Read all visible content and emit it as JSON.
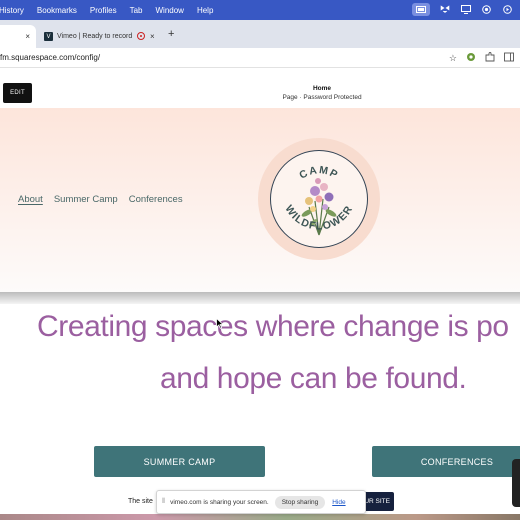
{
  "menubar": {
    "items": [
      "History",
      "Bookmarks",
      "Profiles",
      "Tab",
      "Window",
      "Help"
    ]
  },
  "tabs": {
    "active_close": "×",
    "second_title": "Vimeo | Ready to record",
    "second_favicon": "V",
    "second_close": "×",
    "new_tab": "+"
  },
  "address": {
    "url": "fm.squarespace.com/config/"
  },
  "editor": {
    "edit_label": "EDIT",
    "page_title": "Home",
    "page_subtitle": "Page · Password Protected"
  },
  "site": {
    "nav": [
      {
        "label": "About",
        "current": true
      },
      {
        "label": "Summer Camp",
        "current": false
      },
      {
        "label": "Conferences",
        "current": false
      }
    ],
    "logo_top": "CAMP",
    "logo_bottom": "WILDFLOWER",
    "headline_line1": "Creating spaces where change is po",
    "headline_line2": "and hope can be found.",
    "btn_summer": "SUMMER CAMP",
    "btn_conferences": "CONFERENCES",
    "footer_text": "The site",
    "footer_btn": "UR SITE"
  },
  "share_notice": {
    "grip": "⦀",
    "text": "vimeo.com is sharing your screen.",
    "stop": "Stop sharing",
    "hide": "Hide"
  },
  "colors": {
    "menubar": "#3858c4",
    "headline": "#9b5fa0",
    "teal_button": "#3f7479",
    "nav_text": "#4a6868"
  }
}
